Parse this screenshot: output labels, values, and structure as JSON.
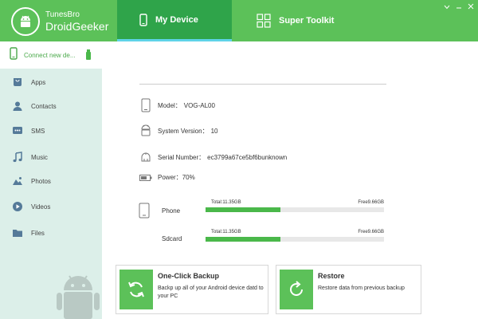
{
  "brand": {
    "line1": "TunesBro",
    "line2": "DroidGeeker"
  },
  "tabs": [
    {
      "label": "My Device",
      "icon": "phone-icon",
      "active": true
    },
    {
      "label": "Super Toolkit",
      "icon": "grid-icon",
      "active": false
    }
  ],
  "window_controls": [
    "menu-icon",
    "minimize-icon",
    "close-icon"
  ],
  "sidebar": {
    "connect": {
      "label": "Connect new de...",
      "icon": "phone-icon",
      "status_icon": "usb-icon"
    },
    "items": [
      {
        "label": "Apps",
        "icon": "apps-icon"
      },
      {
        "label": "Contacts",
        "icon": "contacts-icon"
      },
      {
        "label": "SMS",
        "icon": "sms-icon"
      },
      {
        "label": "Music",
        "icon": "music-icon"
      },
      {
        "label": "Photos",
        "icon": "photos-icon"
      },
      {
        "label": "Videos",
        "icon": "videos-icon"
      },
      {
        "label": "Files",
        "icon": "files-icon"
      }
    ]
  },
  "device": {
    "model": {
      "label": "Model：",
      "value": "VOG-AL00"
    },
    "system_version": {
      "label": "System Version：",
      "value": "10"
    },
    "serial": {
      "label": "Serial Number：",
      "value": "ec3799a67ce5bf6bunknown"
    },
    "power": {
      "label": "Power：",
      "value": "70%"
    }
  },
  "storage": {
    "phone": {
      "label": "Phone",
      "total": "Total:11.35GB",
      "free": "Free9.66GB",
      "used_fraction": 0.42
    },
    "sdcard": {
      "label": "Sdcard",
      "total": "Total:11.35GB",
      "free": "Free9.66GB",
      "used_fraction": 0.42
    }
  },
  "actions": {
    "backup": {
      "title": "One-Click Backup",
      "description": "Backp up all of your Android device datd to your PC"
    },
    "restore": {
      "title": "Restore",
      "description": "Restore data from previous backup"
    }
  },
  "colors": {
    "header": "#5cc159",
    "active_tab": "#2fa44a",
    "tab_underline": "#5fd3e8",
    "sidebar": "#dcefe9",
    "bar_fill": "#4ab84a",
    "accent_text": "#4aa94a"
  }
}
